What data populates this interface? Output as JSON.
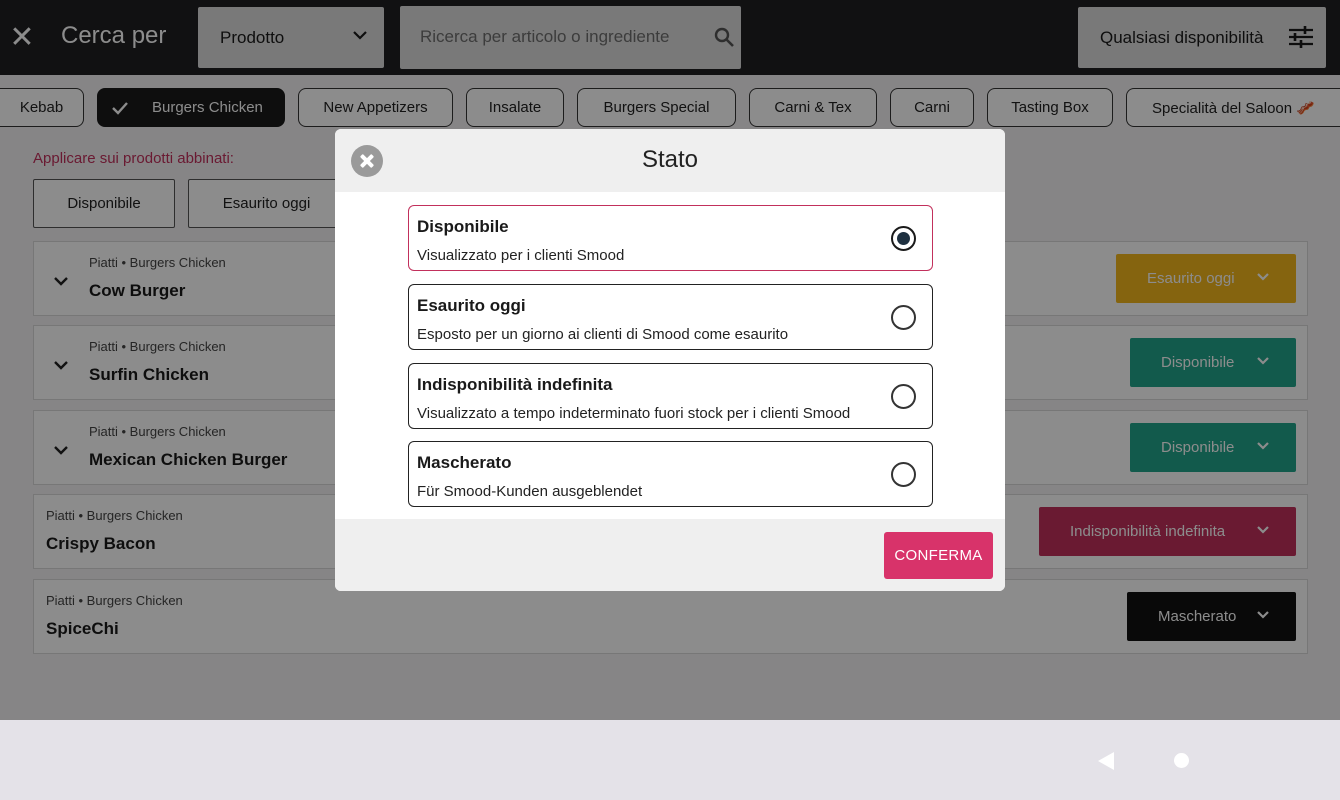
{
  "topbar": {
    "title": "Cerca per",
    "type_select": "Prodotto",
    "search_placeholder": "Ricerca per articolo o ingrediente",
    "availability_select": "Qualsiasi disponibilità"
  },
  "categories": [
    "Kebab",
    "Burgers Chicken",
    "New Appetizers",
    "Insalate",
    "Burgers Special",
    "Carni & Tex",
    "Carni",
    "Tasting Box",
    "Specialità del Saloon 🥓"
  ],
  "apply": {
    "label": "Applicare sui prodotti abbinati:",
    "buttons": [
      "Disponibile",
      "Esaurito oggi"
    ]
  },
  "products": [
    {
      "category": "Piatti • Burgers Chicken",
      "name": "Cow Burger",
      "status": "Esaurito oggi"
    },
    {
      "category": "Piatti • Burgers Chicken",
      "name": "Surfin Chicken",
      "status": "Disponibile"
    },
    {
      "category": "Piatti • Burgers Chicken",
      "name": "Mexican Chicken Burger",
      "status": "Disponibile"
    },
    {
      "category": "Piatti • Burgers Chicken",
      "name": "Crispy Bacon",
      "status": "Indisponibilità indefinita"
    },
    {
      "category": "Piatti • Burgers Chicken",
      "name": "SpiceChi",
      "status": "Mascherato"
    }
  ],
  "status_colors": {
    "Esaurito oggi": "#f2b61d",
    "Disponibile": "#22a48a",
    "Indisponibilità indefinita": "#c2305c",
    "Mascherato": "#111111"
  },
  "modal": {
    "title": "Stato",
    "options": [
      {
        "title": "Disponibile",
        "desc": "Visualizzato per i clienti Smood",
        "selected": true
      },
      {
        "title": "Esaurito oggi",
        "desc": "Esposto per un giorno ai clienti di Smood come esaurito",
        "selected": false
      },
      {
        "title": "Indisponibilità indefinita",
        "desc": "Visualizzato a tempo indeterminato fuori stock per i clienti Smood",
        "selected": false
      },
      {
        "title": "Mascherato",
        "desc": "Für Smood-Kunden ausgeblendet",
        "selected": false
      }
    ],
    "confirm": "CONFERMA"
  }
}
